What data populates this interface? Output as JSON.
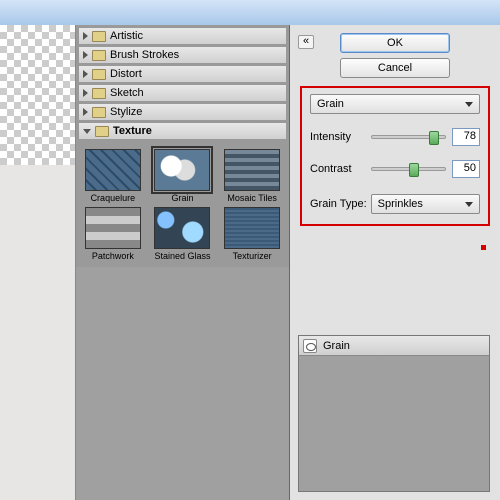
{
  "buttons": {
    "ok": "OK",
    "cancel": "Cancel"
  },
  "categories": [
    {
      "label": "Artistic",
      "expanded": false
    },
    {
      "label": "Brush Strokes",
      "expanded": false
    },
    {
      "label": "Distort",
      "expanded": false
    },
    {
      "label": "Sketch",
      "expanded": false
    },
    {
      "label": "Stylize",
      "expanded": false
    },
    {
      "label": "Texture",
      "expanded": true
    }
  ],
  "thumbnails": [
    {
      "label": "Craquelure"
    },
    {
      "label": "Grain"
    },
    {
      "label": "Mosaic Tiles"
    },
    {
      "label": "Patchwork"
    },
    {
      "label": "Stained Glass"
    },
    {
      "label": "Texturizer"
    }
  ],
  "selected_thumb": 1,
  "filter_dropdown": "Grain",
  "sliders": {
    "intensity": {
      "label": "Intensity",
      "value": "78",
      "pct": 78
    },
    "contrast": {
      "label": "Contrast",
      "value": "50",
      "pct": 50
    }
  },
  "grain_type": {
    "label": "Grain Type:",
    "value": "Sprinkles"
  },
  "layers": {
    "item": "Grain"
  },
  "collapse_glyph": "«"
}
